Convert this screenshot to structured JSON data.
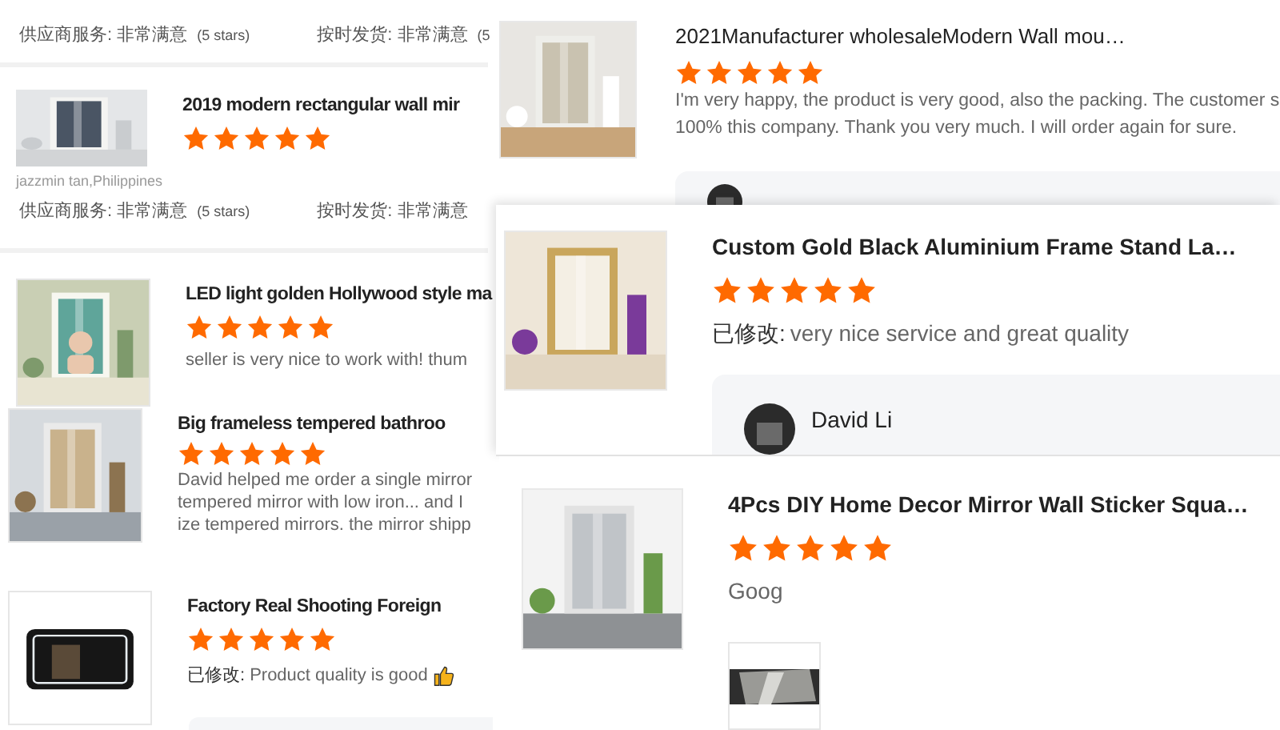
{
  "left_reviews": [
    {
      "ratings": [
        {
          "label": "供应商服务: 非常满意",
          "note": "(5 stars)"
        },
        {
          "label": "按时发货: 非常满意",
          "note": "(5"
        }
      ]
    },
    {
      "title": "2019 modern rectangular wall mir",
      "stars": 5,
      "image": {
        "kind": "picture"
      },
      "reviewer": "jazzmin tan,Philippines",
      "ratings": [
        {
          "label": "供应商服务: 非常满意",
          "note": "(5 stars)"
        },
        {
          "label": "按时发货: 非常满意"
        }
      ]
    },
    {
      "title": "LED light golden Hollywood style ma",
      "stars": 5,
      "image": {
        "kind": "picture"
      },
      "text": [
        "seller is very nice to work with! thum"
      ]
    },
    {
      "title": "Big frameless tempered bathroo",
      "stars": 5,
      "image": {
        "kind": "picture"
      },
      "text": [
        "David helped me order a single mirror",
        "tempered mirror with low iron... and I",
        "ize tempered mirrors. the mirror shipp"
      ]
    },
    {
      "title": "Factory Real Shooting Foreign",
      "stars": 5,
      "image": {
        "kind": "picture"
      },
      "edited_prefix": "已修改:",
      "text": [
        "Product quality is good"
      ],
      "thumbs_up": true
    }
  ],
  "panels": [
    {
      "title": "2021Manufacturer wholesaleModern Wall mou…",
      "stars": 5,
      "image": {
        "kind": "picture"
      },
      "text": [
        "I'm very happy, the product is very good, also the packing. The customer s",
        "100% this company. Thank you very much. I will order again for sure."
      ],
      "reply_box": true
    },
    {
      "title": "Custom Gold Black Aluminium Frame Stand La…",
      "stars": 5,
      "image": {
        "kind": "picture"
      },
      "edited_prefix": "已修改:",
      "text": [
        "very nice service and great quality"
      ],
      "reply": {
        "name": "David Li"
      }
    },
    {
      "title": "4Pcs DIY Home Decor Mirror Wall Sticker Squa…",
      "stars": 5,
      "image": {
        "kind": "picture"
      },
      "text": [
        "Goog"
      ],
      "attachment": {
        "kind": "picture"
      }
    }
  ]
}
